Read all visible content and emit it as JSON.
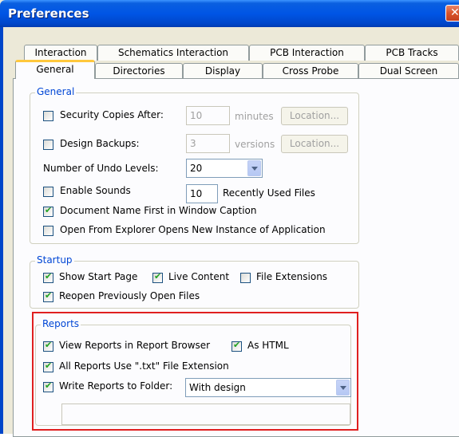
{
  "window": {
    "title": "Preferences"
  },
  "tabs_back": [
    "Interaction",
    "Schematics Interaction",
    "PCB Interaction",
    "PCB Tracks"
  ],
  "tabs_front": [
    "General",
    "Directories",
    "Display",
    "Cross Probe",
    "Dual Screen"
  ],
  "general": {
    "legend": "General",
    "security_copies": {
      "label": "Security Copies After:",
      "checked": false,
      "value": "10",
      "unit": "minutes",
      "location": "Location..."
    },
    "design_backups": {
      "label": "Design Backups:",
      "checked": false,
      "value": "3",
      "unit": "versions",
      "location": "Location..."
    },
    "undo": {
      "label": "Number of Undo Levels:",
      "value": "20"
    },
    "sounds": {
      "label": "Enable Sounds",
      "checked": false
    },
    "recent": {
      "value": "10",
      "label": "Recently Used Files"
    },
    "doc_name_first": {
      "label": "Document Name First in Window Caption",
      "checked": true
    },
    "explorer_new_instance": {
      "label": "Open From Explorer Opens New Instance of Application",
      "checked": false
    }
  },
  "startup": {
    "legend": "Startup",
    "show_start_page": {
      "label": "Show Start Page",
      "checked": true
    },
    "live_content": {
      "label": "Live Content",
      "checked": true
    },
    "file_extensions": {
      "label": "File Extensions",
      "checked": false
    },
    "reopen": {
      "label": "Reopen Previously Open Files",
      "checked": true
    }
  },
  "reports": {
    "legend": "Reports",
    "view_in_browser": {
      "label": "View Reports in Report Browser",
      "checked": true
    },
    "as_html": {
      "label": "As HTML",
      "checked": true
    },
    "txt_extension": {
      "label": "All Reports Use \".txt\" File Extension",
      "checked": true
    },
    "write_to_folder": {
      "label": "Write Reports to Folder:",
      "checked": true,
      "value": "With design"
    },
    "folder_path": ""
  },
  "colors": {
    "title_bar": "#0055e5",
    "highlight": "#e02020",
    "legend_text": "#0046d5",
    "active_tab_accent": "#ffc83c"
  }
}
